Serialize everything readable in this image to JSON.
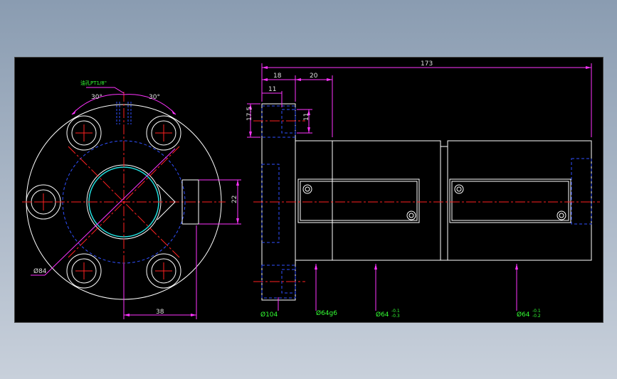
{
  "drawing": {
    "note_thread": "油孔PT1/8\"",
    "angle_left": "30°",
    "angle_right": "30°",
    "dim_bore_circle": "Ø84",
    "dim_offset": "38",
    "dim_port_height": "22",
    "dim_total_length": "173",
    "dim_flange_width": "18",
    "dim_step": "20",
    "dim_counterbore": "11",
    "dim_bolt_offset": "17.5",
    "dim_hole_height": "11",
    "dim_flange_dia": "Ø104",
    "dim_body_fit": "Ø64g6",
    "dim_body_1": "Ø64",
    "tol_body_1_upper": "-0.1",
    "tol_body_1_lower": "-0.3",
    "dim_body_2": "Ø64",
    "tol_body_2_upper": "-0.1",
    "tol_body_2_lower": "-0.2"
  },
  "colors": {
    "background": "#000000",
    "outline": "#ffffff",
    "center_line": "#ff2020",
    "hidden_line": "#3050ff",
    "dimension": "#ff33ff",
    "text": "#33ff33",
    "bore_highlight": "#22dddd"
  }
}
